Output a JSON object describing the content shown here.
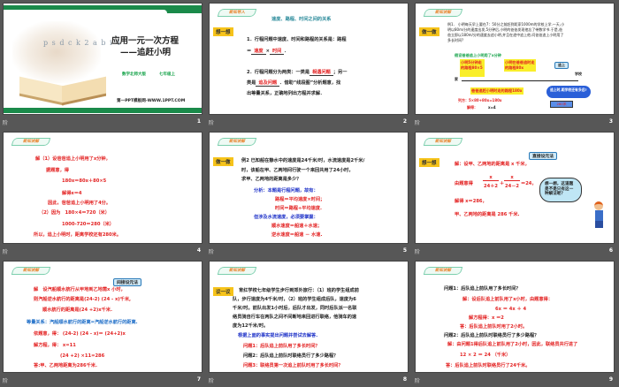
{
  "footer_icon": "阶",
  "colors": {
    "green": "#1a8a4a",
    "red": "#e32222",
    "blue": "#1e32c8",
    "yellow": "#f6c31a",
    "background": "#575757"
  },
  "slides": [
    {
      "num": "1",
      "title1": "应用一元一次方程",
      "title2": "——追赶小明",
      "edition": "数学北师大版",
      "grade": "七年级上",
      "site": "第一PPT模板网-WWW.1PPT.COM",
      "letters": "p s d c k 2 a b i 4"
    },
    {
      "num": "2",
      "badge": "新知导入",
      "heading": "速度、路程、时间之间的关系",
      "tag": "想一想",
      "l1": "1．行程问题中速度、时间和路程的关系是：路程",
      "l2a": "＝",
      "l2b": "速度",
      "l2c": "×",
      "l2d": "时间",
      "l2e": "．",
      "l3a": "2．行程问题分为两类：一类是",
      "l3b": "相遇问题",
      "l3c": "；另一",
      "l4a": "类是",
      "l4b": "追及问题",
      "l4c": "．借助“线段图”分析题意，找",
      "l5": "出等量关系，正确地列出方程并求解．"
    },
    {
      "num": "3",
      "badge": "新知讲解",
      "tag": "做一做",
      "p1": "例1． 小明每天早上要在7：50分之前赶到距家1000m的学校上学.一天,小",
      "p2": "明以80m/分的速度出发,5分钟后,小明的爸爸发现他忘了带数学书.于是,爸",
      "p3": "爸立即以180m/分的速度去追小明,并且在途中追上他.问爸爸追上小明用了",
      "p4": "多长时间?",
      "assume": "假设爸爸追上小明用了x分钟",
      "box1": "小明5分钟走的路程80×5",
      "box2": "小明在爸爸追时走的路程80x",
      "catch": "追上",
      "home": "家",
      "school": "学校",
      "box3": "爸爸追赶小明时走的路程180x",
      "cloud": "追上时,距学校还有多远?",
      "dist": "280米",
      "eq": "列方：5×80+80x=180x",
      "sol": "解得：",
      "solx": "x=4"
    },
    {
      "num": "4",
      "badge": "新知讲解",
      "lines": [
        "解（1）设爸爸追上小明用了x分钟，",
        "据题意，得",
        "180x＝80x＋80×5",
        "解得x＝4",
        "因此，爸爸追上小明用了4分。",
        "（2）因为　180×4＝720（米）",
        "1000-720＝280（米）",
        "所以，追上小明时，距离学校还有280米。"
      ]
    },
    {
      "num": "5",
      "badge": "新知讲解",
      "tag": "做一做",
      "q1": "例2  已知船在静水中的速度是24千米/时，水流速度是2千米/",
      "q2": "时，该船在甲、乙两地间行驶一个来回共用了24小时，",
      "q3": "求甲、乙两地的距离是多少？",
      "a1": "分析：本题是行程问题，故有：",
      "a2": "路程＝平均速度×时间；",
      "a3": "时间＝路程÷平均速度.",
      "a4": "但涉及水流速度，必须要掌握：",
      "a5": "顺水速度＝船速＋水速；",
      "a6": "逆水速度＝船速 － 水速."
    },
    {
      "num": "6",
      "badge": "新知讲解",
      "tag": "想一想",
      "note": "直接设元法",
      "s1": "解：设甲、乙两地的距离是 x 千米，",
      "s2": "由题意得",
      "n1": "x",
      "d1": "24＋2",
      "plus": "＋",
      "n2": "x",
      "d2": "24－2",
      "s2b": "＝24，",
      "s3": "解得 x＝286，",
      "s4": "甲、乙两地的距离是 286 千米.",
      "cloud": "想一想，这道题是不是只有这一种解法呢？"
    },
    {
      "num": "7",
      "badge": "新知讲解",
      "note": "间接设元法",
      "lines": [
        "解　设汽船顺水航行从甲地到乙地需x 小时，",
        "则汽船逆水航行的距离是(24-2) (24 - x)千米,",
        "顺水航行的距离是(24 +2)x千米."
      ],
      "rel": "等量关系：汽船顺水航行的距离=汽船逆水航行的距离.",
      "lines2": [
        "依题意，得：  (24-2) (24 - x)＝ (24+2)x",
        "解方程，得：      x=11",
        "(24 +2) ×11=286",
        "答:甲、乙两地距离为286千米."
      ]
    },
    {
      "num": "8",
      "badge": "新知讲解",
      "tag": "议一议",
      "p": [
        "育红学校七年级学生步行到郊外旅行：（1）班的学生组成前",
        "队，步行速度为4千米/时，（2）班的学生组成后队，速度为6",
        "千米/时。前队出发1小时后，后队才出发，同时后队派一名联",
        "络员骑自行车在两队之间不间断地来回进行联络，他骑车的速",
        "度为12千米/时。"
      ],
      "prompt": "根据上面的事实提出问题并尝试去解答.",
      "q1": "问题1：后队追上前队用了多长时间？",
      "q2": "问题2：后队追上前队时联络员行了多少路程？",
      "q3": "问题3：联络员第一次追上前队时用了多长时间？"
    },
    {
      "num": "9",
      "badge": "新知讲解",
      "lines": [
        "问题1：后队追上前队用了多长时间？",
        "解：设后队追上前队用了x小时，由题意得：",
        "6x ＝ 4x ＋ 4",
        "解方程得：x ＝2",
        "答：后队追上前队时用了2小时。",
        "问题2：后队追上前队时联络员行了多少路程？",
        "解：由问题1得后队追上前队用了2小时，因此，联络员共行进了",
        "12 × 2 ＝ 24 （千米）",
        "答：后队追上前队时联络员行了24千米。"
      ]
    }
  ]
}
